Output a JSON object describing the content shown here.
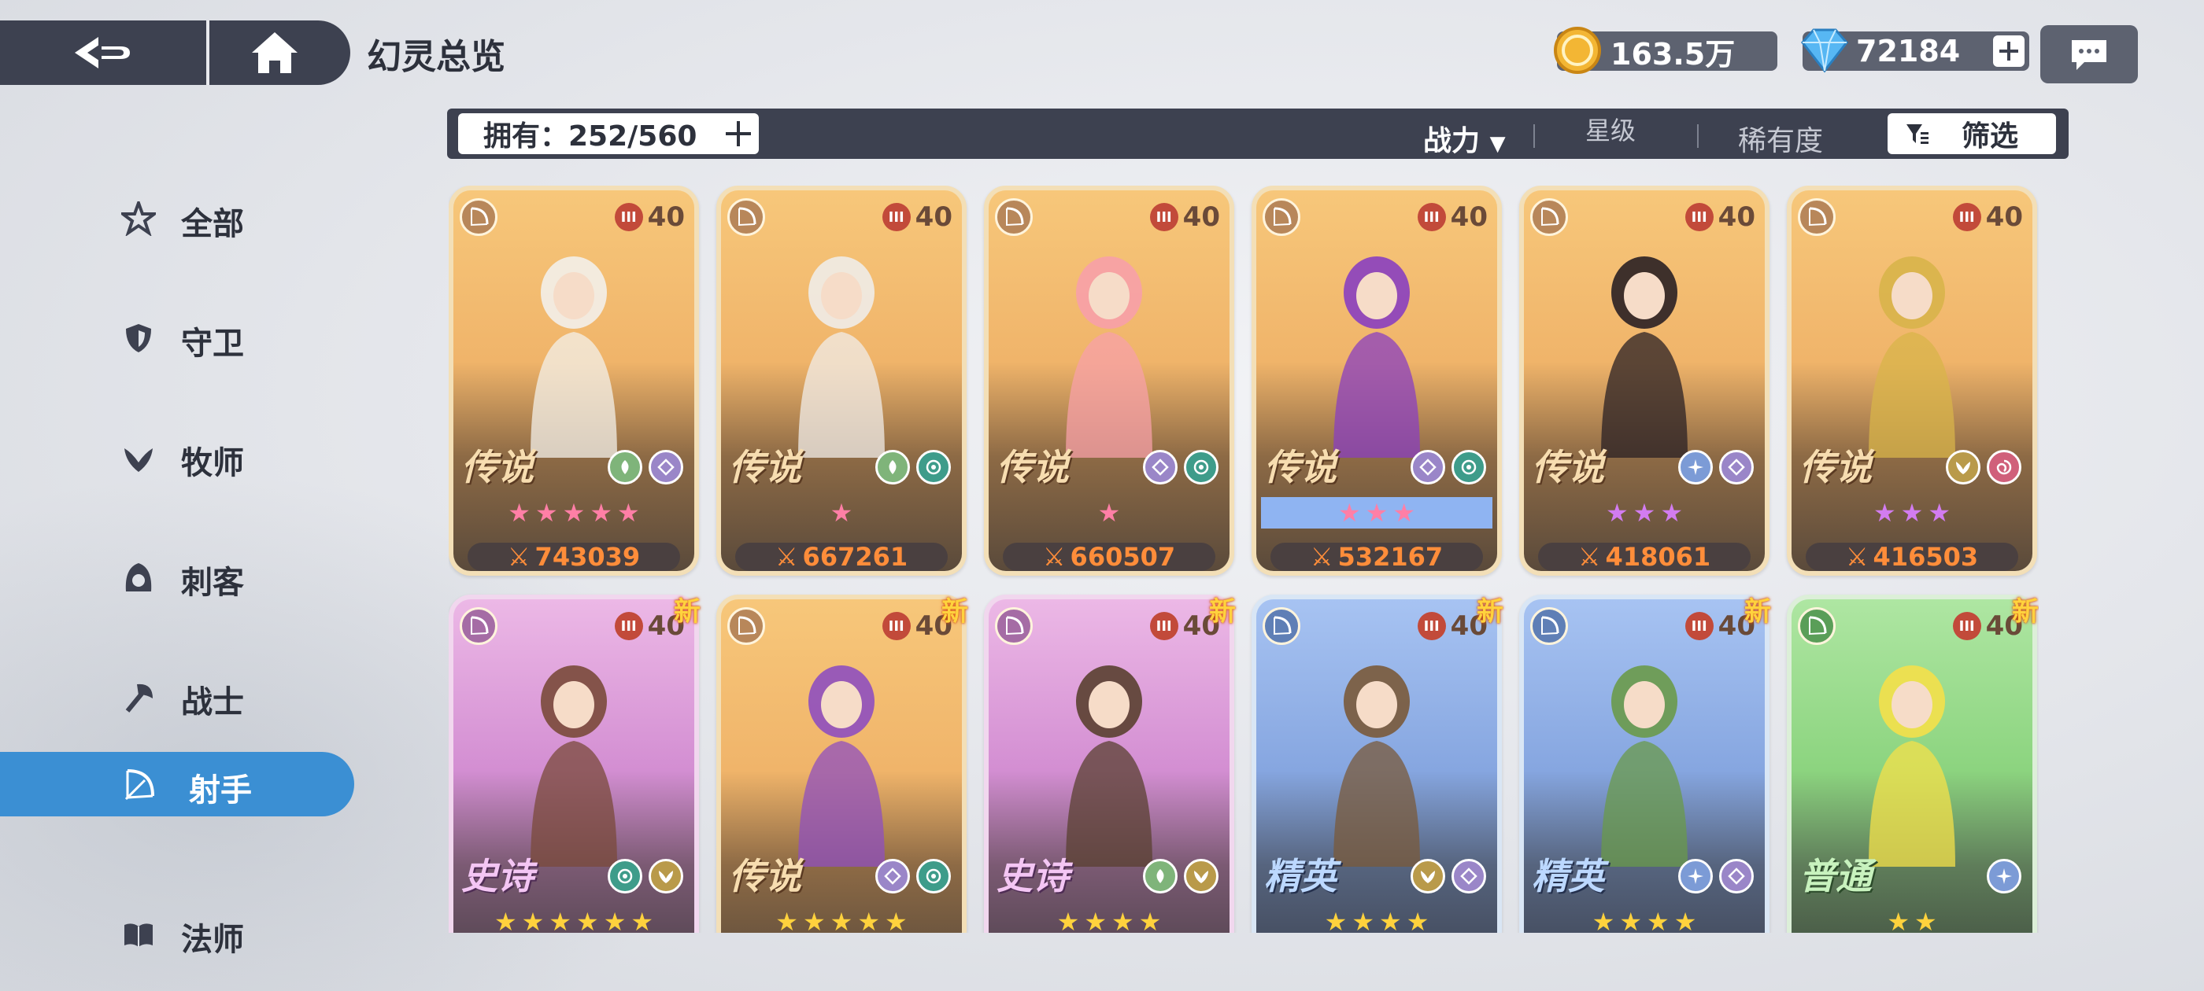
{
  "header": {
    "title": "幻灵总览",
    "gold": "163.5万",
    "gems": "72184"
  },
  "filterbar": {
    "owned": "拥有：252/560",
    "sort_power": "战力",
    "sort_star": "星级",
    "sort_rarity": "稀有度",
    "filter": "筛选"
  },
  "sidebar": {
    "items": [
      {
        "label": "全部",
        "icon": "all-icon"
      },
      {
        "label": "守卫",
        "icon": "shield-icon"
      },
      {
        "label": "牧师",
        "icon": "wing-icon"
      },
      {
        "label": "刺客",
        "icon": "hood-icon"
      },
      {
        "label": "战士",
        "icon": "axe-icon"
      },
      {
        "label": "射手",
        "icon": "bow-icon"
      },
      {
        "label": "法师",
        "icon": "book-icon"
      }
    ],
    "active_index": 5
  },
  "colors": {
    "dark": "#3d4150",
    "accent": "#3b8fd3",
    "power": "#ff8d3a",
    "star_pink": "#ff7fa6",
    "star_purple": "#d27cf0",
    "star_gold": "#ffd23d"
  },
  "cards": [
    {
      "rarity": "传说",
      "level": "40",
      "stars": 5,
      "star_color": "#ff7fa6",
      "power": "743039",
      "is_new": false,
      "tier": "legend",
      "elements": [
        "leaf-icon",
        "diamond-icon"
      ],
      "palette": "#f3f0ea"
    },
    {
      "rarity": "传说",
      "level": "40",
      "stars": 1,
      "star_color": "#ff7fa6",
      "power": "667261",
      "is_new": false,
      "tier": "legend",
      "elements": [
        "leaf-icon",
        "moon-icon"
      ],
      "palette": "#f0ece8"
    },
    {
      "rarity": "传说",
      "level": "40",
      "stars": 1,
      "star_color": "#ff7fa6",
      "power": "660507",
      "is_new": false,
      "tier": "legend",
      "elements": [
        "diamond-icon",
        "moon-icon"
      ],
      "palette": "#f7a0a8"
    },
    {
      "rarity": "传说",
      "level": "40",
      "stars": 3,
      "star_color": "#ff7fa6",
      "power": "532167",
      "is_new": false,
      "tier": "legend",
      "elements": [
        "diamond-icon",
        "moon-icon"
      ],
      "palette": "#8a3fc0",
      "star_highlight": true
    },
    {
      "rarity": "传说",
      "level": "40",
      "stars": 3,
      "star_color": "#d27cf0",
      "power": "418061",
      "is_new": false,
      "tier": "legend",
      "elements": [
        "star-icon",
        "diamond-icon"
      ],
      "palette": "#2a2024"
    },
    {
      "rarity": "传说",
      "level": "40",
      "stars": 3,
      "star_color": "#d27cf0",
      "power": "416503",
      "is_new": false,
      "tier": "legend",
      "elements": [
        "wing-icon",
        "swirl-icon"
      ],
      "palette": "#d8b44a"
    },
    {
      "rarity": "史诗",
      "level": "40",
      "stars": 6,
      "star_color": "#ffd23d",
      "power": "",
      "is_new": true,
      "tier": "epic",
      "elements": [
        "moon-icon",
        "wing-icon"
      ],
      "palette": "#7a4a3a"
    },
    {
      "rarity": "传说",
      "level": "40",
      "stars": 5,
      "star_color": "#ffd23d",
      "power": "",
      "is_new": true,
      "tier": "legend",
      "elements": [
        "diamond-icon",
        "moon-icon"
      ],
      "palette": "#8f4fbf"
    },
    {
      "rarity": "史诗",
      "level": "40",
      "stars": 4,
      "star_color": "#ffd23d",
      "power": "",
      "is_new": true,
      "tier": "epic",
      "elements": [
        "leaf-icon",
        "wing-icon"
      ],
      "palette": "#5a4030"
    },
    {
      "rarity": "精英",
      "level": "40",
      "stars": 4,
      "star_color": "#ffd23d",
      "power": "",
      "is_new": true,
      "tier": "elite",
      "elements": [
        "wing-icon",
        "diamond-icon"
      ],
      "palette": "#7a5a3a"
    },
    {
      "rarity": "精英",
      "level": "40",
      "stars": 4,
      "star_color": "#ffd23d",
      "power": "",
      "is_new": true,
      "tier": "elite",
      "elements": [
        "star-icon",
        "diamond-icon"
      ],
      "palette": "#6a9a4a"
    },
    {
      "rarity": "普通",
      "level": "40",
      "stars": 2,
      "star_color": "#ffd23d",
      "power": "",
      "is_new": true,
      "tier": "common",
      "elements": [
        "star-icon"
      ],
      "palette": "#f4e04a"
    }
  ]
}
